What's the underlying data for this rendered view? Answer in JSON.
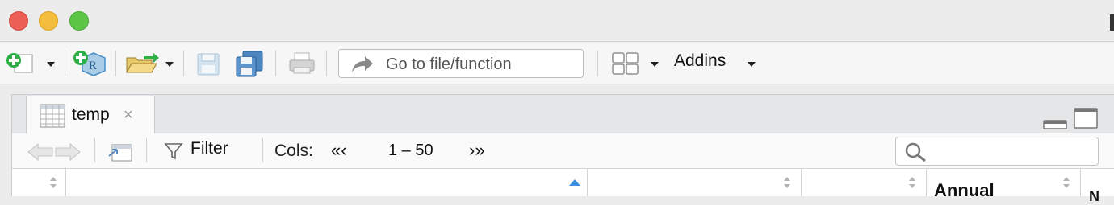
{
  "toolbar": {
    "goto_placeholder": "Go to file/function",
    "addins_label": "Addins"
  },
  "tabs": [
    {
      "label": "temp",
      "close": "×"
    }
  ],
  "viewer": {
    "filter_label": "Filter",
    "cols_label": "Cols:",
    "prev_label": "«‹",
    "range_label": "1 – 50",
    "next_label": "›»",
    "search_value": ""
  },
  "table": {
    "headers": [
      "",
      "",
      "",
      "",
      "Annual",
      "N"
    ],
    "sorted_column_index": 1,
    "sorted_direction": "ascending"
  },
  "colors": {
    "close": "#ec5f56",
    "minimize": "#f5bd3c",
    "maximize": "#5dc647",
    "sort_active": "#3a8de0",
    "new_file_green": "#2eae46",
    "project_blue": "#4a8fc7"
  }
}
